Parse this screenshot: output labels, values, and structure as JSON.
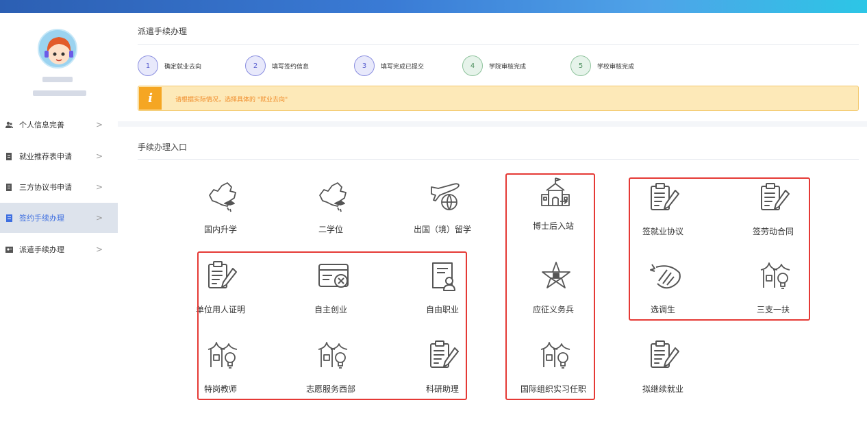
{
  "sidebar": {
    "items": [
      {
        "label": "个人信息完善",
        "icon": "users-icon"
      },
      {
        "label": "就业推荐表申请",
        "icon": "document-icon"
      },
      {
        "label": "三方协议书申请",
        "icon": "document-icon"
      },
      {
        "label": "签约手续办理",
        "icon": "list-icon",
        "active": true
      },
      {
        "label": "派遣手续办理",
        "icon": "id-card-icon"
      }
    ],
    "chevron": ">"
  },
  "process": {
    "title": "派遣手续办理",
    "steps": [
      {
        "num": "1",
        "label": "确定就业去向"
      },
      {
        "num": "2",
        "label": "填写签约信息"
      },
      {
        "num": "3",
        "label": "填写完成已提交"
      },
      {
        "num": "4",
        "label": "学院审核完成"
      },
      {
        "num": "5",
        "label": "学校审核完成"
      }
    ],
    "alert_icon": "i",
    "alert_text": "请根据实际情况，选择具体的 \"就业去向\""
  },
  "entry": {
    "title": "手续办理入口",
    "tiles": [
      {
        "label": "国内升学",
        "icon": "china-map-graduation-icon"
      },
      {
        "label": "二学位",
        "icon": "china-map-graduation-icon"
      },
      {
        "label": "出国（境）留学",
        "icon": "airplane-globe-icon"
      },
      {
        "label": "博士后入站",
        "icon": "school-building-icon"
      },
      {
        "label": "签就业协议",
        "icon": "clipboard-pen-icon"
      },
      {
        "label": "签劳动合同",
        "icon": "clipboard-pen-icon"
      },
      {
        "label": "单位用人证明",
        "icon": "clipboard-pen-icon"
      },
      {
        "label": "自主创业",
        "icon": "card-tools-icon"
      },
      {
        "label": "自由职业",
        "icon": "profile-document-icon"
      },
      {
        "label": "应征义务兵",
        "icon": "army-star-icon"
      },
      {
        "label": "选调生",
        "icon": "ribbon-emblem-icon"
      },
      {
        "label": "三支一扶",
        "icon": "village-lightbulb-icon"
      },
      {
        "label": "特岗教师",
        "icon": "village-lightbulb-icon"
      },
      {
        "label": "志愿服务西部",
        "icon": "village-lightbulb-icon"
      },
      {
        "label": "科研助理",
        "icon": "clipboard-pen-icon"
      },
      {
        "label": "国际组织实习任职",
        "icon": "village-lightbulb-icon"
      },
      {
        "label": "拟继续就业",
        "icon": "clipboard-pen-icon"
      }
    ]
  },
  "colors": {
    "accent": "#3d6ee0",
    "highlight": "#e53935",
    "alert_bg": "#fde9b8",
    "alert_text": "#f08c2a"
  }
}
